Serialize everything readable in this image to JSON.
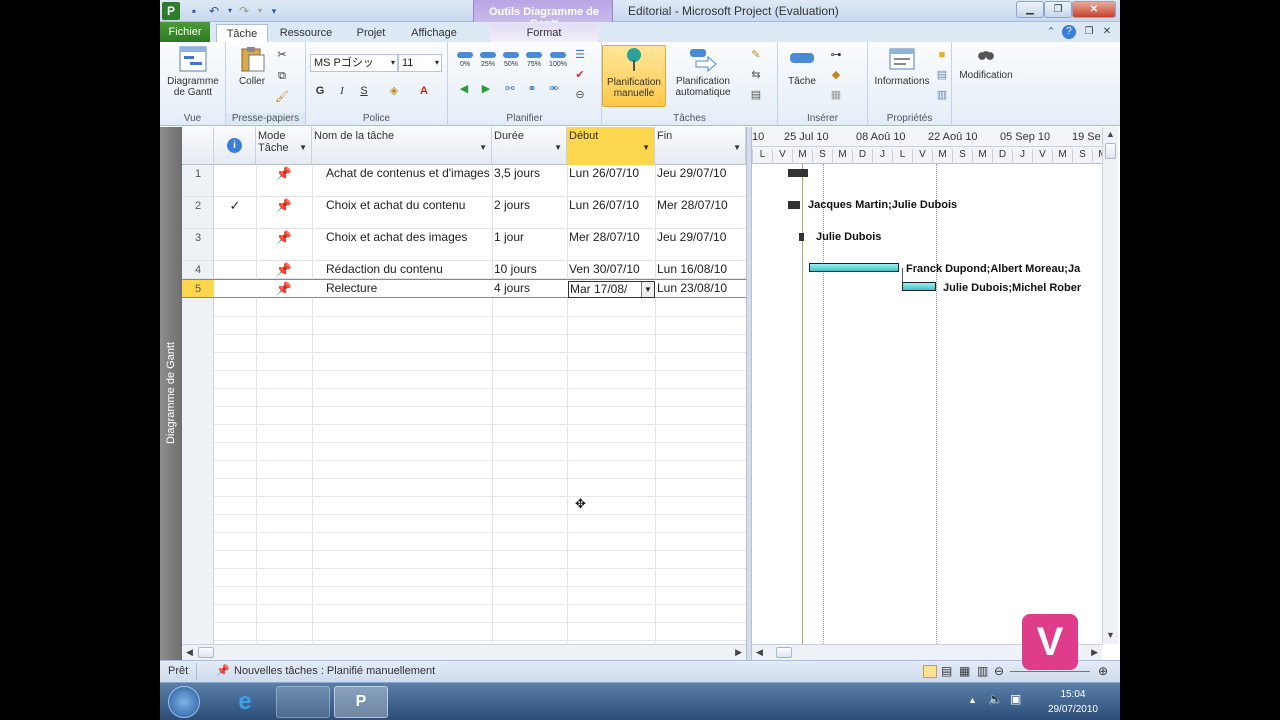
{
  "window": {
    "title": "Editorial  -  Microsoft Project (Evaluation)",
    "context_tab_group": "Outils Diagramme de Gantt"
  },
  "tabs": [
    "Fichier",
    "Tâche",
    "Ressource",
    "Projet",
    "Affichage",
    "Format"
  ],
  "ribbon": {
    "groups": {
      "vue": "Vue",
      "presse_papiers": "Presse-papiers",
      "police": "Police",
      "planifier": "Planifier",
      "taches": "Tâches",
      "inserer": "Insérer",
      "proprietes": "Propriétés"
    },
    "gantt_btn": "Diagramme de Gantt",
    "coller_btn": "Coller",
    "font_name": "MS Pゴシッ",
    "font_size": "11",
    "bold": "G",
    "italic": "I",
    "underline": "S",
    "pct_labels": [
      "0%",
      "25%",
      "50%",
      "75%",
      "100%"
    ],
    "planif_manuelle": "Planification manuelle",
    "planif_auto": "Planification automatique",
    "tache_btn": "Tâche",
    "informations_btn": "Informations",
    "modification_btn": "Modification"
  },
  "view_label": "Diagramme de Gantt",
  "grid": {
    "headers": {
      "info": "i",
      "mode": "Mode Tâche",
      "name": "Nom de la tâche",
      "duration": "Durée",
      "start": "Début",
      "finish": "Fin"
    },
    "rows": [
      {
        "num": "1",
        "indicator": "",
        "name": "Achat de contenus et d'images",
        "duration": "3,5 jours",
        "start": "Lun 26/07/10",
        "finish": "Jeu 29/07/10"
      },
      {
        "num": "2",
        "indicator": "✓",
        "name": "Choix et achat du contenu",
        "duration": "2 jours",
        "start": "Lun 26/07/10",
        "finish": "Mer 28/07/10"
      },
      {
        "num": "3",
        "indicator": "",
        "name": "Choix et achat des images",
        "duration": "1 jour",
        "start": "Mer 28/07/10",
        "finish": "Jeu 29/07/10"
      },
      {
        "num": "4",
        "indicator": "",
        "name": "Rédaction du contenu",
        "duration": "10 jours",
        "start": "Ven 30/07/10",
        "finish": "Lun 16/08/10"
      },
      {
        "num": "5",
        "indicator": "",
        "name": "Relecture",
        "duration": "4 jours",
        "start": "Mar 17/08/",
        "finish": "Lun 23/08/10"
      }
    ]
  },
  "gantt": {
    "weeks": [
      "10",
      "25 Jul 10",
      "08 Aoû 10",
      "22 Aoû 10",
      "05 Sep 10",
      "19 Se"
    ],
    "days": [
      "L",
      "V",
      "M",
      "S",
      "M",
      "D",
      "J",
      "L",
      "V",
      "M",
      "S",
      "M",
      "D",
      "J",
      "V",
      "M",
      "S",
      "M"
    ],
    "labels": [
      "Jacques Martin;Julie Dubois",
      "Julie Dubois",
      "Franck Dupond;Albert Moreau;Ja",
      "Julie Dubois;Michel Rober"
    ]
  },
  "statusbar": {
    "ready": "Prêt",
    "new_tasks": "Nouvelles tâches : Planifié manuellement"
  },
  "taskbar": {
    "time": "15:04",
    "date": "29/07/2010"
  },
  "brand_logo": "V"
}
